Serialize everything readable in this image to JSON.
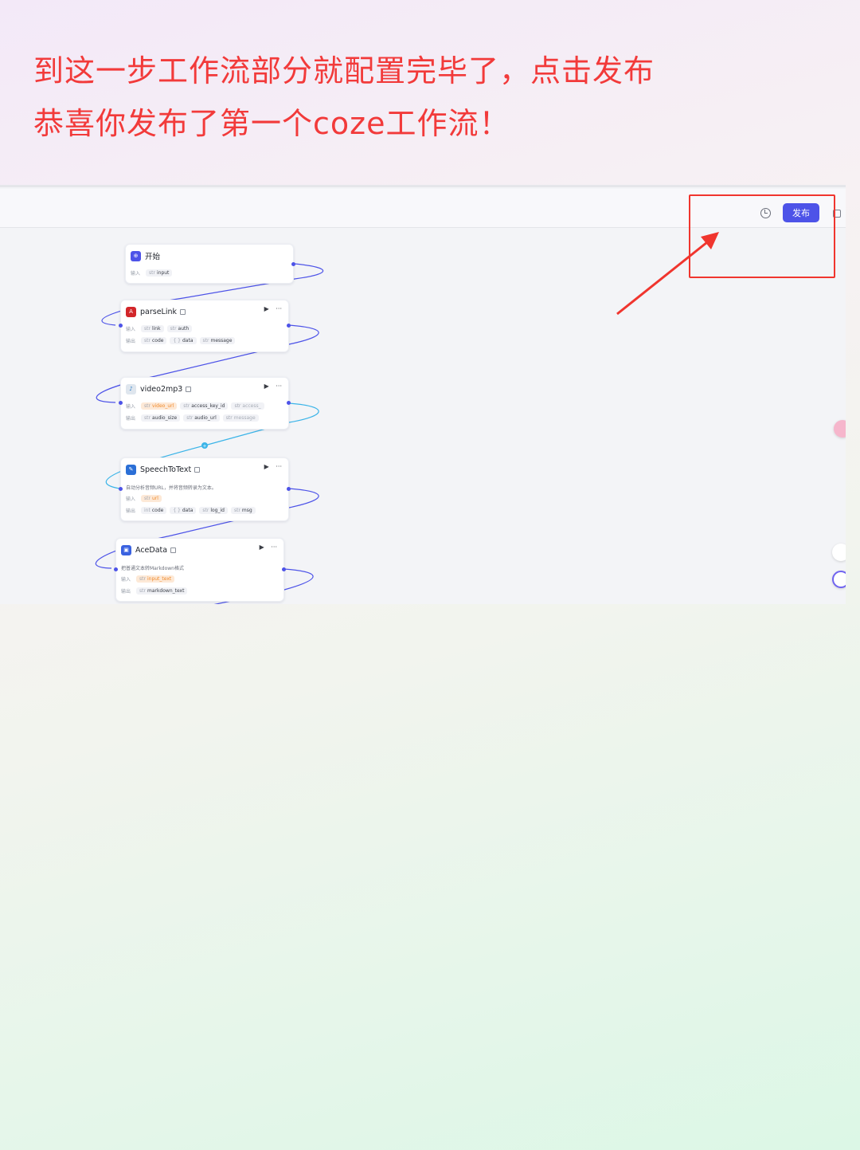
{
  "caption": {
    "line1": "到这一步工作流部分就配置完毕了，点击发布",
    "line2": "恭喜你发布了第一个coze工作流！"
  },
  "toolbar": {
    "history_icon": "history-icon",
    "publish_label": "发布",
    "copy_icon": "copy-icon"
  },
  "colors": {
    "caption": "#f23a3a",
    "publish_button": "#4d53e8",
    "wire": "#4d53e8",
    "wire_active": "#3bb4e8",
    "annotation": "#f0352e"
  },
  "nodes": {
    "start": {
      "title": "开始",
      "input_label": "输入",
      "inputs": [
        "input"
      ]
    },
    "parselink": {
      "title": "parseLink",
      "input_label": "输入",
      "inputs": [
        "link",
        "auth"
      ],
      "output_label": "输出",
      "outputs": [
        "code",
        "data",
        "message"
      ]
    },
    "video2mp3": {
      "title": "video2mp3",
      "input_label": "输入",
      "inputs": [
        "video_url",
        "access_key_id",
        "access_"
      ],
      "output_label": "输出",
      "outputs": [
        "audio_size",
        "audio_url",
        "message"
      ]
    },
    "speechtotext": {
      "title": "SpeechToText",
      "desc": "自动分析音频URL，并将音频转录为文本。",
      "input_label": "输入",
      "inputs": [
        "url"
      ],
      "output_label": "输出",
      "outputs": [
        "code",
        "data",
        "log_id",
        "msg"
      ]
    },
    "acedata": {
      "title": "AceData",
      "desc": "把普通文本转Markdown格式",
      "input_label": "输入",
      "inputs": [
        "input_text"
      ],
      "output_label": "输出",
      "outputs": [
        "markdown_text"
      ]
    }
  },
  "node_actions": {
    "run": "▶",
    "more": "···"
  }
}
